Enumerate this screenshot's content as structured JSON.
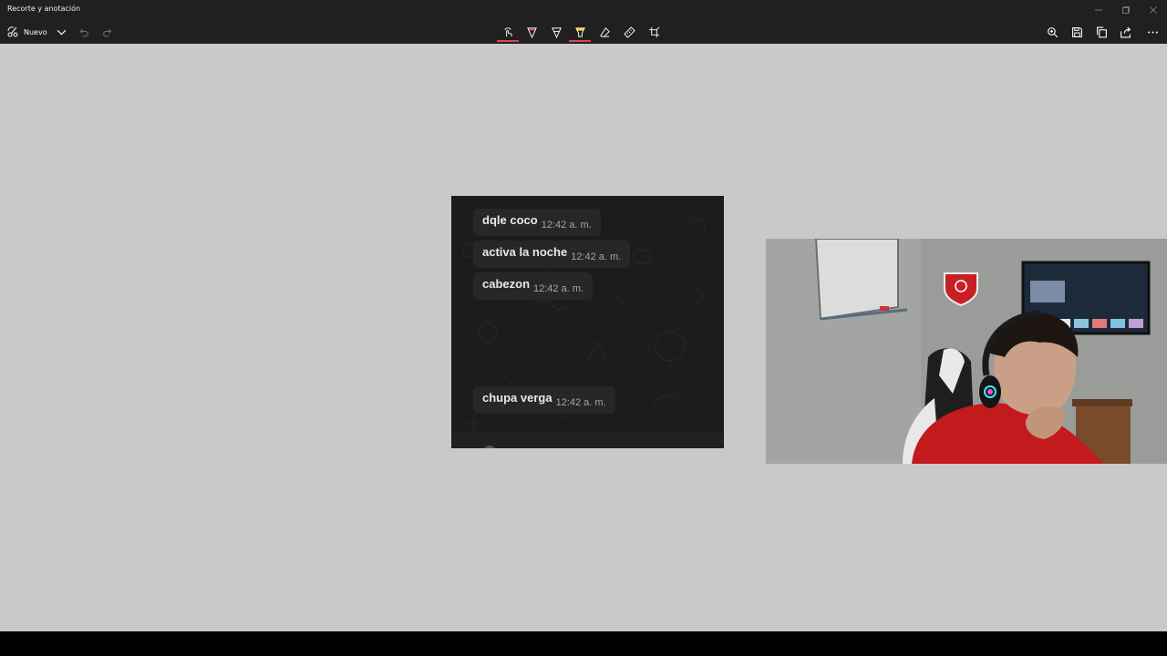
{
  "window": {
    "title": "Recorte y anotación",
    "controls": [
      "minimize-icon",
      "restore-icon",
      "close-icon"
    ]
  },
  "toolbar": {
    "new_label": "Nuevo",
    "left_icons": [
      "chevron-down-icon",
      "undo-icon",
      "redo-icon"
    ],
    "tools": [
      {
        "name": "touch-writing-icon",
        "active_color": "#e8414f"
      },
      {
        "name": "ballpoint-pen-icon",
        "color": "#e8414f"
      },
      {
        "name": "pencil-icon",
        "color": "#ffffff"
      },
      {
        "name": "highlighter-icon",
        "color": "#ffe600",
        "active_color": "#e8414f"
      },
      {
        "name": "eraser-icon"
      },
      {
        "name": "ruler-icon"
      },
      {
        "name": "crop-icon"
      }
    ],
    "right_icons": [
      "zoom-icon",
      "save-icon",
      "copy-icon",
      "share-icon",
      "more-icon"
    ]
  },
  "chat": {
    "messages": [
      {
        "text": "dqle coco",
        "time": "12:42 a. m."
      },
      {
        "text": "activa la noche",
        "time": "12:42 a. m."
      },
      {
        "text": "cabezon",
        "time": "12:42 a. m."
      },
      {
        "text": "chupa verga",
        "time": "12:42 a. m."
      }
    ]
  },
  "webcam": {
    "description_icon": "webcam-feed"
  },
  "colors": {
    "titlebar": "#202020",
    "canvas": "#c9c9c9",
    "chat_bg": "#1b1c1c",
    "bubble": "#262727",
    "accent_red": "#e8414f",
    "highlighter_yellow": "#ffe600"
  }
}
